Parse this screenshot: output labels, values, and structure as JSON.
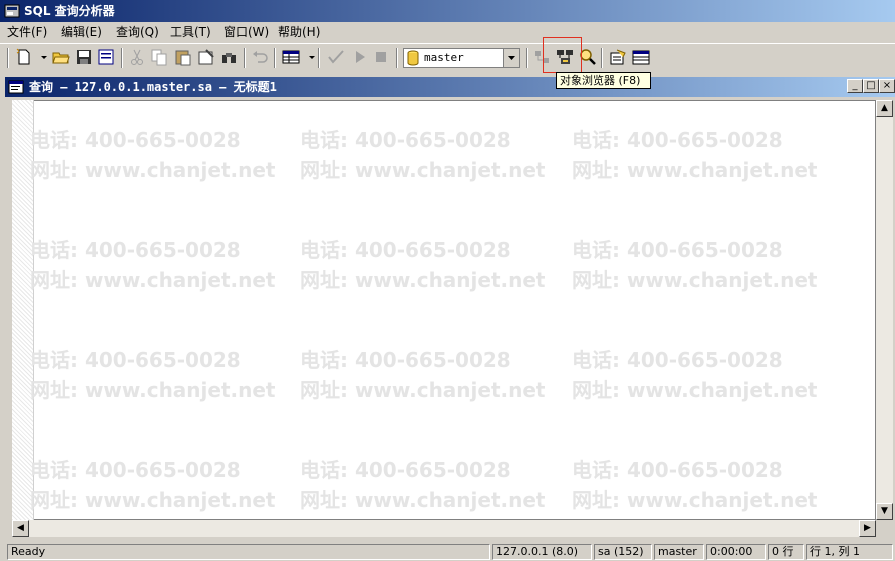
{
  "app": {
    "title": "SQL 查询分析器"
  },
  "menu": {
    "items": [
      {
        "label": "文件(F)"
      },
      {
        "label": "编辑(E)"
      },
      {
        "label": "查询(Q)"
      },
      {
        "label": "工具(T)"
      },
      {
        "label": "窗口(W)"
      },
      {
        "label": "帮助(H)"
      }
    ]
  },
  "toolbar": {
    "database_selected": "master",
    "tooltip": "对象浏览器 (F8)",
    "highlight_color": "#e03020"
  },
  "query_window": {
    "title": "查询 — 127.0.0.1.master.sa — 无标题1",
    "minimize": "_",
    "restore": "□",
    "close": "×"
  },
  "watermark": {
    "phone": "电话: 400-665-0028",
    "site": "网址: www.chanjet.net"
  },
  "statusbar": {
    "ready": "Ready",
    "server": "127.0.0.1 (8.0)",
    "user": "sa (152)",
    "database": "master",
    "time": "0:00:00",
    "rows": "0 行",
    "position": "行 1, 列 1"
  },
  "colors": {
    "title_start": "#0a246a",
    "title_end": "#a6caf0",
    "face": "#d4d0c8"
  }
}
